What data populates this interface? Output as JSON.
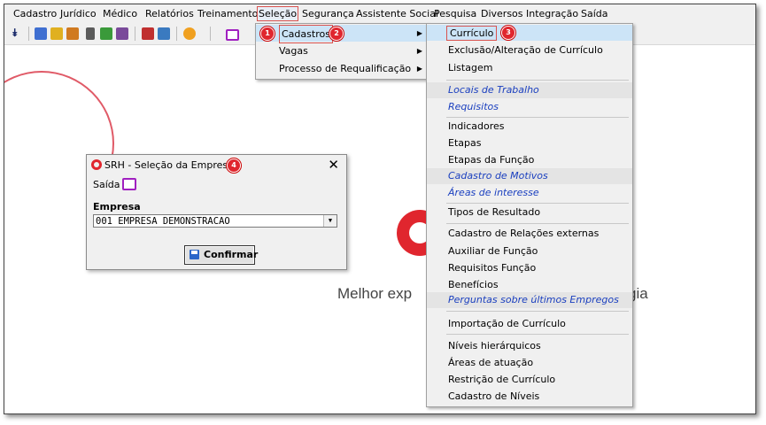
{
  "menubar": {
    "items": [
      "Cadastro",
      "Jurídico",
      "Médico",
      "Relatórios",
      "Treinamento",
      "Seleção",
      "Segurança",
      "Assistente Social",
      "Pesquisa",
      "Diversos",
      "Integração",
      "Saída"
    ]
  },
  "selecao_menu": {
    "items": [
      "Cadastros",
      "Vagas",
      "Processo de Requalificação"
    ]
  },
  "cadastros_menu": {
    "items": [
      "Currículo",
      "Exclusão/Alteração de Currículo",
      "Listagem",
      "Locais de Trabalho",
      "Requisitos",
      "Indicadores",
      "Etapas",
      "Etapas da Função",
      "Cadastro de Motivos",
      "Áreas de interesse",
      "Tipos de Resultado",
      "Cadastro de Relações externas",
      "Auxiliar de Função",
      "Requisitos Função",
      "Benefícios",
      "Perguntas sobre últimos Empregos",
      "Importação de Currículo",
      "Níveis hierárquicos",
      "Áreas de atuação",
      "Restrição de Currículo",
      "Cadastro de Níveis"
    ]
  },
  "badges": [
    "1",
    "2",
    "3",
    "4"
  ],
  "background": {
    "tagline_left": "Melhor exp",
    "tagline_right": "gia"
  },
  "dialog": {
    "title": "SRH - Seleção da Empresa",
    "close": "✕",
    "saida_label": "Saída",
    "empresa_label": "Empresa",
    "empresa_value": "001 EMPRESA DEMONSTRACAO",
    "confirm_label": "Confirmar"
  },
  "colors": {
    "accent_red": "#e0262e",
    "highlight": "#cce4f7",
    "italic_link": "#1a3fbf"
  }
}
